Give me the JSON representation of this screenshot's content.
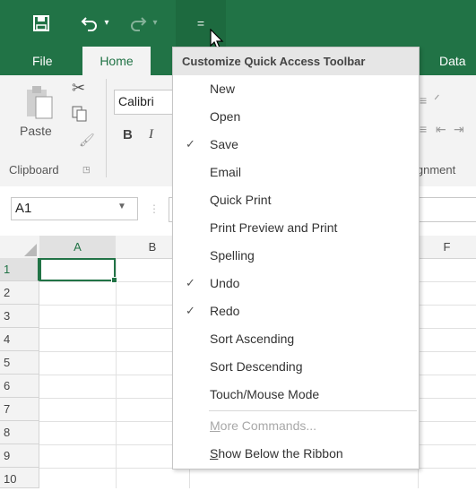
{
  "colors": {
    "excel_green": "#217346",
    "ribbon_bg": "#f3f3f3",
    "menu_header_bg": "#e6e6e6"
  },
  "qat": {
    "save_icon": "save-icon",
    "undo_icon": "undo-icon",
    "redo_icon": "redo-icon",
    "customize_icon": "customize-qat-icon",
    "customize_glyph": "="
  },
  "tabs": {
    "file": "File",
    "home": "Home",
    "data": "Data"
  },
  "ribbon": {
    "paste": "Paste",
    "font_name": "Calibri",
    "bold": "B",
    "italic": "I",
    "clipboard": "Clipboard",
    "alignment": "ignment"
  },
  "formula_bar": {
    "name_box": "A1"
  },
  "columns": [
    "A",
    "B",
    "F"
  ],
  "rows": [
    "1",
    "2",
    "3",
    "4",
    "5",
    "6",
    "7",
    "8",
    "9",
    "10"
  ],
  "menu": {
    "title": "Customize Quick Access Toolbar",
    "items": [
      {
        "label": "New",
        "checked": false
      },
      {
        "label": "Open",
        "checked": false
      },
      {
        "label": "Save",
        "checked": true
      },
      {
        "label": "Email",
        "checked": false
      },
      {
        "label": "Quick Print",
        "checked": false
      },
      {
        "label": "Print Preview and Print",
        "checked": false
      },
      {
        "label": "Spelling",
        "checked": false
      },
      {
        "label": "Undo",
        "checked": true
      },
      {
        "label": "Redo",
        "checked": true
      },
      {
        "label": "Sort Ascending",
        "checked": false
      },
      {
        "label": "Sort Descending",
        "checked": false
      },
      {
        "label": "Touch/Mouse Mode",
        "checked": false
      }
    ],
    "more_commands_first": "M",
    "more_commands_rest": "ore Commands...",
    "show_below_first": "S",
    "show_below_rest": "how Below the Ribbon",
    "check_glyph": "✓"
  }
}
